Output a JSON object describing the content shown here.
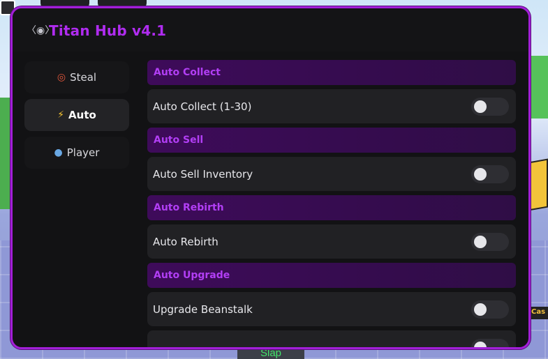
{
  "window": {
    "title": "Titan Hub v4.1",
    "icon": "gamepad-icon"
  },
  "sidebar": {
    "tabs": [
      {
        "label": "Steal",
        "icon": "target-icon",
        "active": false
      },
      {
        "label": "Auto",
        "icon": "lightning-icon",
        "active": true
      },
      {
        "label": "Player",
        "icon": "user-icon",
        "active": false
      }
    ]
  },
  "main": {
    "sections": [
      {
        "header": "Auto Collect",
        "toggle_label": "Auto Collect (1-30)",
        "enabled": false
      },
      {
        "header": "Auto Sell",
        "toggle_label": "Auto Sell Inventory",
        "enabled": false
      },
      {
        "header": "Auto Rebirth",
        "toggle_label": "Auto Rebirth",
        "enabled": false
      },
      {
        "header": "Auto Upgrade",
        "toggle_label": "Upgrade Beanstalk",
        "enabled": false
      }
    ]
  },
  "game": {
    "slap_button": "Slap",
    "cash_tag": "Cas"
  },
  "colors": {
    "accent": "#a21fd8",
    "title": "#b02cf0",
    "panel_bg": "#121214",
    "section_bg": "#3e0b5a",
    "row_bg": "#212124"
  }
}
